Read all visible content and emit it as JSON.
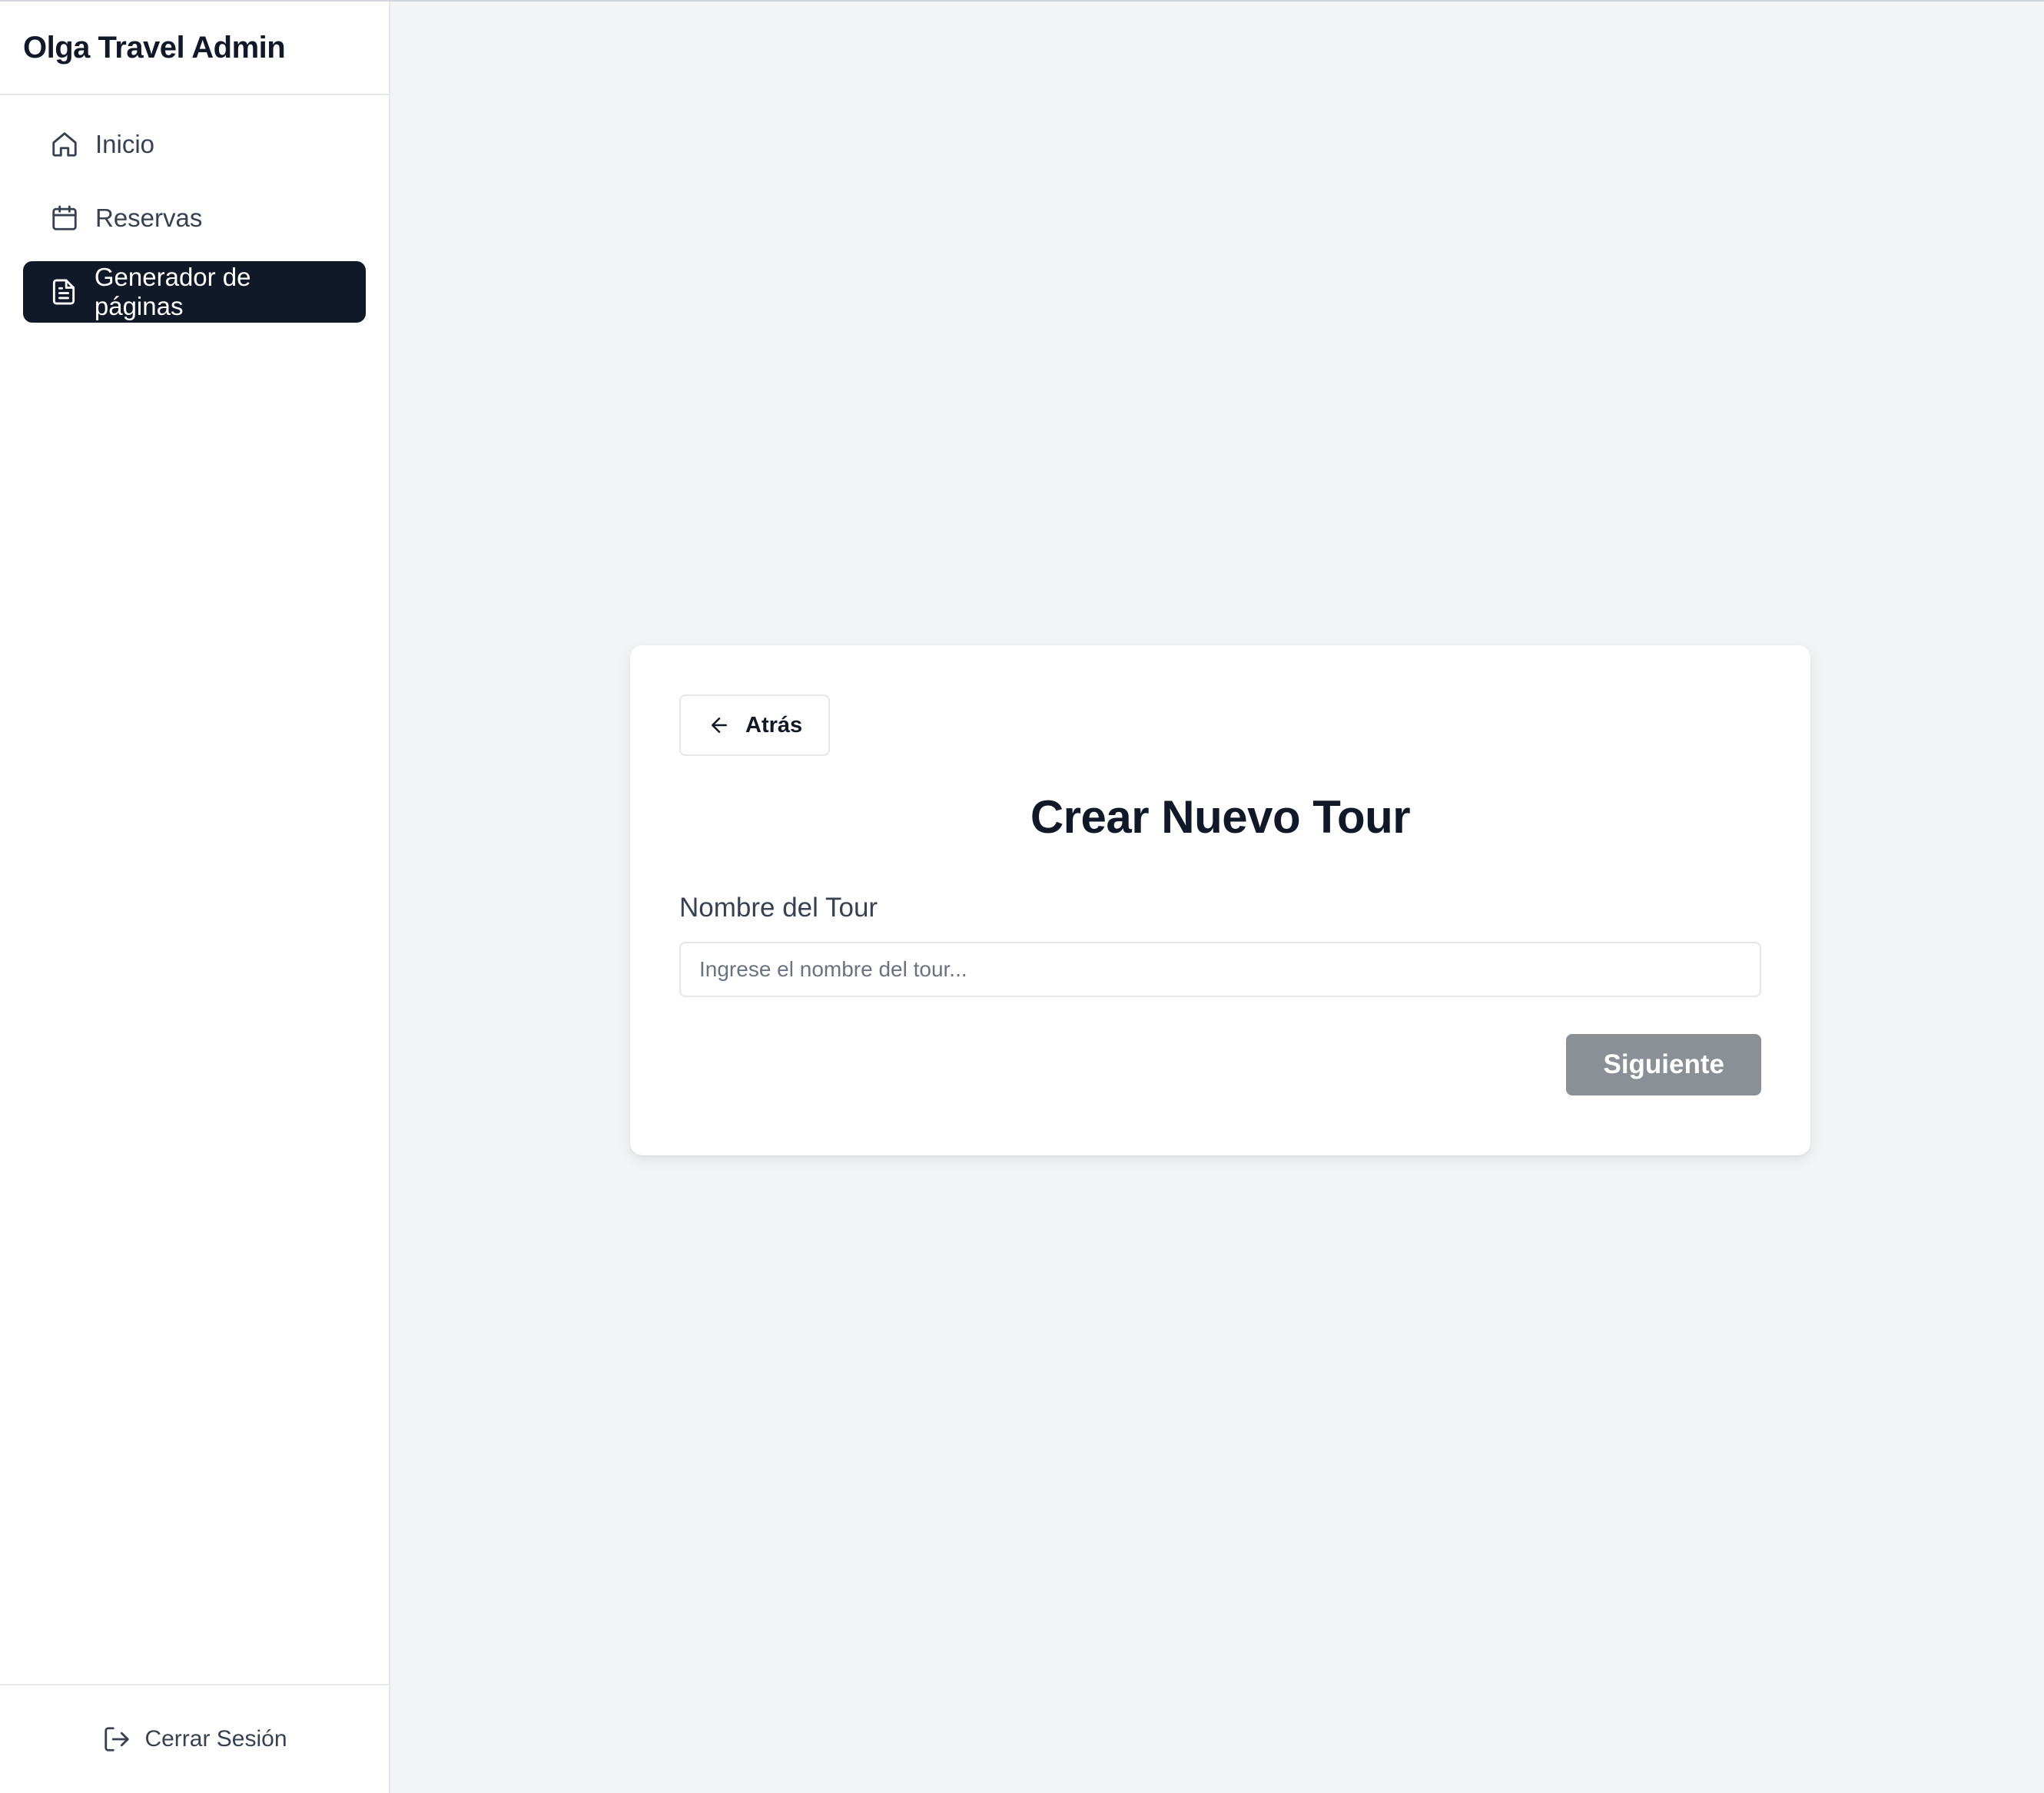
{
  "app": {
    "title": "Olga Travel Admin"
  },
  "sidebar": {
    "items": [
      {
        "label": "Inicio",
        "icon": "home-icon",
        "active": false
      },
      {
        "label": "Reservas",
        "icon": "calendar-icon",
        "active": false
      },
      {
        "label": "Generador de páginas",
        "icon": "document-icon",
        "active": true
      }
    ],
    "logout_label": "Cerrar Sesión",
    "logout_icon": "logout-icon"
  },
  "main": {
    "back_label": "Atrás",
    "back_icon": "arrow-left-icon",
    "title": "Crear Nuevo Tour",
    "field_label": "Nombre del Tour",
    "field_value": "",
    "field_placeholder": "Ingrese el nombre del tour...",
    "next_label": "Siguiente",
    "next_disabled": true
  },
  "colors": {
    "accent": "#111827",
    "background": "#f3f4f6",
    "disabled_button": "#8b9097"
  }
}
